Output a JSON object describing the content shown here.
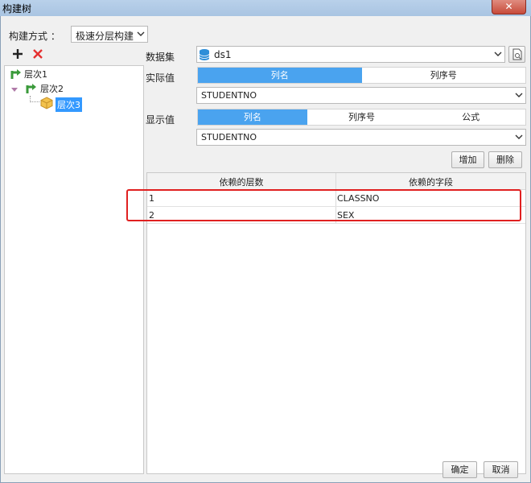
{
  "window": {
    "title": "构建树",
    "close_glyph": "✕"
  },
  "build_mode": {
    "label": "构建方式 ：",
    "value": "极速分层构建"
  },
  "tree": {
    "items": [
      {
        "label": "层次1"
      },
      {
        "label": "层次2"
      },
      {
        "label": "层次3"
      }
    ]
  },
  "dataset": {
    "label": "数据集",
    "value": "ds1"
  },
  "actual_value": {
    "label": "实际值",
    "tabs": [
      "列名",
      "列序号"
    ],
    "selected_tab": "列名",
    "column": "STUDENTNO"
  },
  "display_value": {
    "label": "显示值",
    "tabs": [
      "列名",
      "列序号",
      "公式"
    ],
    "selected_tab": "列名",
    "column": "STUDENTNO"
  },
  "buttons": {
    "add": "增加",
    "delete": "删除",
    "ok": "确定",
    "cancel": "取消"
  },
  "table": {
    "headers": [
      "依赖的层数",
      "依赖的字段"
    ],
    "rows": [
      [
        "1",
        "CLASSNO"
      ],
      [
        "2",
        "SEX"
      ]
    ]
  },
  "colors": {
    "accent": "#4aa3ef",
    "selection": "#3399ff",
    "highlight_box": "#e02020"
  }
}
